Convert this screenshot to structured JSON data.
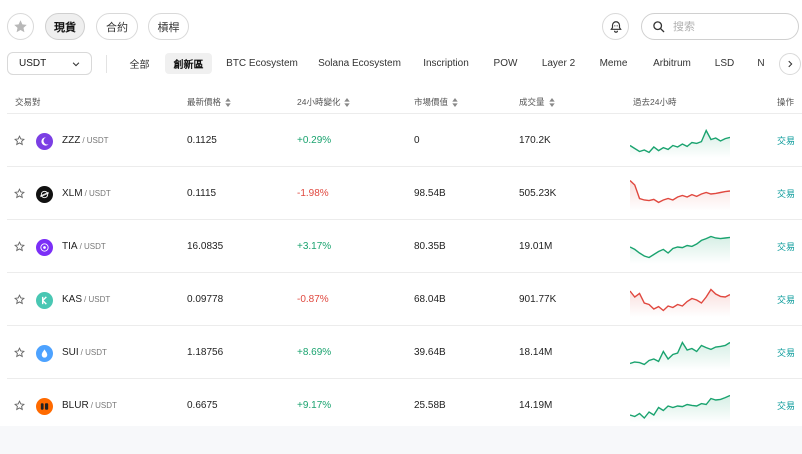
{
  "topbar": {
    "favorites_icon": "star-icon",
    "tabs": [
      {
        "label": "現貨",
        "active": true
      },
      {
        "label": "合約",
        "active": false
      },
      {
        "label": "槓桿",
        "active": false
      }
    ],
    "notification_icon": "bell-icon",
    "search": {
      "placeholder": "搜索",
      "value": ""
    }
  },
  "filters": {
    "quote_select": "USDT",
    "categories": [
      {
        "label": "全部",
        "active": false
      },
      {
        "label": "創新區",
        "active": true
      },
      {
        "label": "BTC Ecosystem",
        "active": false
      },
      {
        "label": "Solana Ecosystem",
        "active": false
      },
      {
        "label": "Inscription",
        "active": false
      },
      {
        "label": "POW",
        "active": false
      },
      {
        "label": "Layer 2",
        "active": false
      },
      {
        "label": "Meme",
        "active": false
      },
      {
        "label": "Arbitrum",
        "active": false
      },
      {
        "label": "LSD",
        "active": false
      },
      {
        "label": "N",
        "active": false
      }
    ]
  },
  "table": {
    "headers": {
      "pair": "交易對",
      "price": "最新價格",
      "change": "24小時變化",
      "mcap": "市場價值",
      "volume": "成交量",
      "chart": "過去24小時",
      "action": "操作"
    },
    "rows": [
      {
        "base": "ZZZ",
        "quote": "/ USDT",
        "price": "0.1125",
        "change": "+0.29%",
        "direction": "up",
        "mcap": "0",
        "volume": "170.2K",
        "trade": "交易",
        "icon_color": "#7b3fe4",
        "icon": "moon-icon",
        "spark": [
          0.35,
          0.25,
          0.15,
          0.2,
          0.12,
          0.3,
          0.18,
          0.28,
          0.22,
          0.35,
          0.3,
          0.4,
          0.32,
          0.45,
          0.42,
          0.48,
          0.85,
          0.55,
          0.6,
          0.5,
          0.58,
          0.62
        ]
      },
      {
        "base": "XLM",
        "quote": "/ USDT",
        "price": "0.1115",
        "change": "-1.98%",
        "direction": "down",
        "mcap": "98.54B",
        "volume": "505.23K",
        "trade": "交易",
        "icon_color": "#111111",
        "icon": "stellar-icon",
        "spark": [
          0.95,
          0.8,
          0.35,
          0.3,
          0.28,
          0.32,
          0.22,
          0.3,
          0.35,
          0.3,
          0.4,
          0.45,
          0.4,
          0.48,
          0.42,
          0.5,
          0.55,
          0.5,
          0.52,
          0.55,
          0.58,
          0.6
        ]
      },
      {
        "base": "TIA",
        "quote": "/ USDT",
        "price": "16.0835",
        "change": "+3.17%",
        "direction": "up",
        "mcap": "80.35B",
        "volume": "19.01M",
        "trade": "交易",
        "icon_color": "#7b2ff7",
        "icon": "celestia-icon",
        "spark": [
          0.5,
          0.42,
          0.3,
          0.2,
          0.15,
          0.25,
          0.35,
          0.42,
          0.3,
          0.45,
          0.5,
          0.48,
          0.55,
          0.52,
          0.6,
          0.72,
          0.78,
          0.85,
          0.8,
          0.78,
          0.8,
          0.82
        ]
      },
      {
        "base": "KAS",
        "quote": "/ USDT",
        "price": "0.09778",
        "change": "-0.87%",
        "direction": "down",
        "mcap": "68.04B",
        "volume": "901.77K",
        "trade": "交易",
        "icon_color": "#49c7b3",
        "icon": "kaspa-icon",
        "spark": [
          0.8,
          0.6,
          0.72,
          0.4,
          0.35,
          0.2,
          0.28,
          0.15,
          0.3,
          0.25,
          0.35,
          0.3,
          0.45,
          0.55,
          0.5,
          0.4,
          0.6,
          0.85,
          0.7,
          0.62,
          0.6,
          0.68
        ]
      },
      {
        "base": "SUI",
        "quote": "/ USDT",
        "price": "1.18756",
        "change": "+8.69%",
        "direction": "up",
        "mcap": "39.64B",
        "volume": "18.14M",
        "trade": "交易",
        "icon_color": "#4da2ff",
        "icon": "droplet-icon",
        "spark": [
          0.15,
          0.2,
          0.18,
          0.12,
          0.25,
          0.3,
          0.22,
          0.55,
          0.3,
          0.45,
          0.5,
          0.85,
          0.6,
          0.65,
          0.55,
          0.75,
          0.68,
          0.62,
          0.7,
          0.72,
          0.75,
          0.85
        ]
      },
      {
        "base": "BLUR",
        "quote": "/ USDT",
        "price": "0.6675",
        "change": "+9.17%",
        "direction": "up",
        "mcap": "25.58B",
        "volume": "14.19M",
        "trade": "交易",
        "icon_color": "#ff6a00",
        "icon": "blur-icon",
        "spark": [
          0.2,
          0.15,
          0.25,
          0.1,
          0.3,
          0.2,
          0.45,
          0.35,
          0.5,
          0.45,
          0.5,
          0.48,
          0.55,
          0.52,
          0.5,
          0.58,
          0.55,
          0.75,
          0.7,
          0.72,
          0.78,
          0.85
        ]
      }
    ]
  },
  "colors": {
    "up": "#1aa36f",
    "down": "#e0483f",
    "trade_link": "#0a9b9b"
  }
}
